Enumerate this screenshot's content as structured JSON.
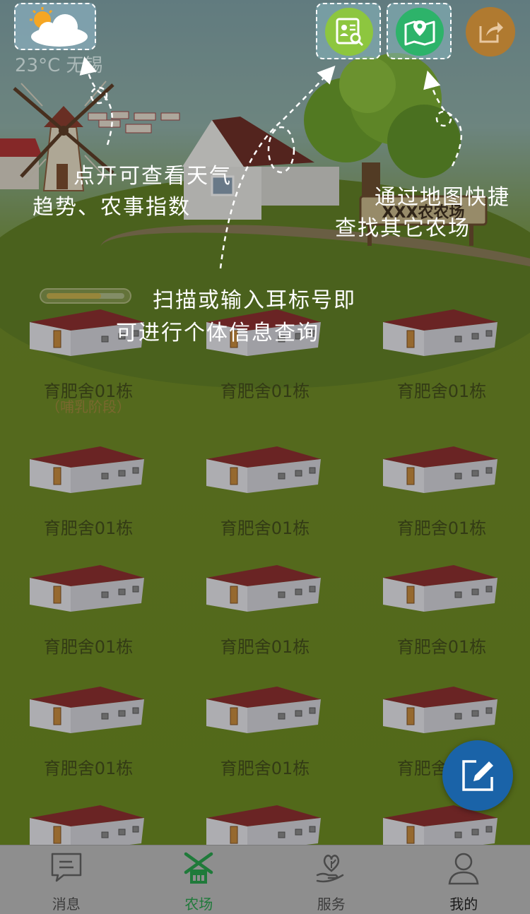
{
  "weather": {
    "temperature": "23°C 无锡",
    "icon": "partly-cloudy-icon"
  },
  "header": {
    "scan_icon": "ear-tag-scan-icon",
    "map_icon": "map-pin-icon",
    "share_icon": "share-icon"
  },
  "annotations": {
    "weather_line1": "点开可查看天气",
    "weather_line2": "趋势、农事指数",
    "map_line1": "通过地图快捷",
    "map_line2": "查找其它农场",
    "scan_line1": "扫描或输入耳标号即",
    "scan_line2": "可进行个体信息查询"
  },
  "sign": {
    "label": "XXX农农场"
  },
  "progress": {
    "value": 0.7
  },
  "barns": [
    {
      "label": "育肥舍01栋",
      "sub": "（哺乳阶段）"
    },
    {
      "label": "育肥舍01栋"
    },
    {
      "label": "育肥舍01栋"
    },
    {
      "label": "育肥舍01栋"
    },
    {
      "label": "育肥舍01栋"
    },
    {
      "label": "育肥舍01栋"
    },
    {
      "label": "育肥舍01栋"
    },
    {
      "label": "育肥舍01栋"
    },
    {
      "label": "育肥舍01栋"
    },
    {
      "label": "育肥舍01栋"
    },
    {
      "label": "育肥舍01栋"
    },
    {
      "label": "育肥舍01栋"
    }
  ],
  "fab": {
    "icon": "edit-icon"
  },
  "tabbar": {
    "items": [
      {
        "label": "消息",
        "icon": "message-icon"
      },
      {
        "label": "农场",
        "icon": "farm-windmill-icon",
        "active": true
      },
      {
        "label": "服务",
        "icon": "service-hand-icon"
      },
      {
        "label": "我的",
        "icon": "user-icon"
      }
    ]
  }
}
